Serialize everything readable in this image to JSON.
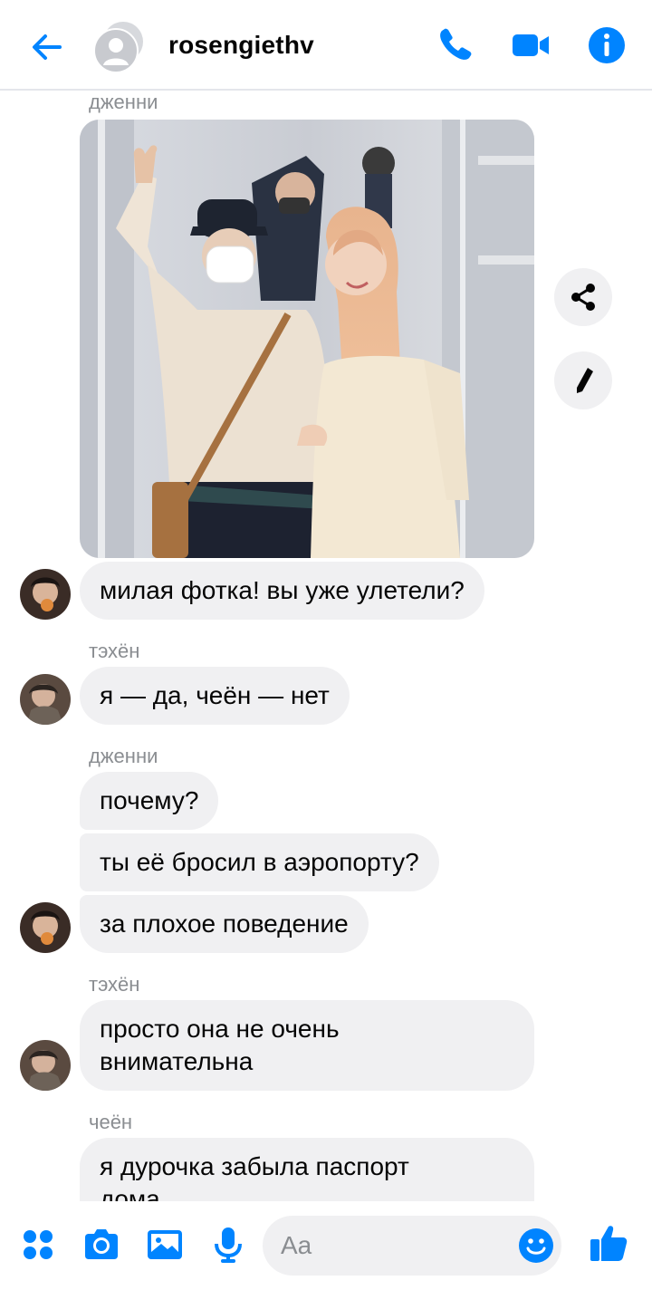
{
  "header": {
    "contact_name": "rosengiethv"
  },
  "messages": {
    "sender_1": "дженни",
    "sender_2": "тэхён",
    "sender_3": "дженни",
    "sender_4": "тэхён",
    "sender_5": "чеён",
    "m1": "милая фотка! вы уже улетели?",
    "m2": "я — да, чеён — нет",
    "m3": "почему?",
    "m4": "ты её бросил в аэропорту?",
    "m5": "за плохое поведение",
    "m6_line1": "просто она не очень",
    "m6_line2": "внимательна",
    "m7_line1": "я дурочка забыла паспорт",
    "m7_line2": "дома"
  },
  "composer": {
    "placeholder": "Aa"
  },
  "colors": {
    "accent": "#0084ff",
    "bubble": "#f0f0f2",
    "sender_label": "#8a8d91"
  }
}
